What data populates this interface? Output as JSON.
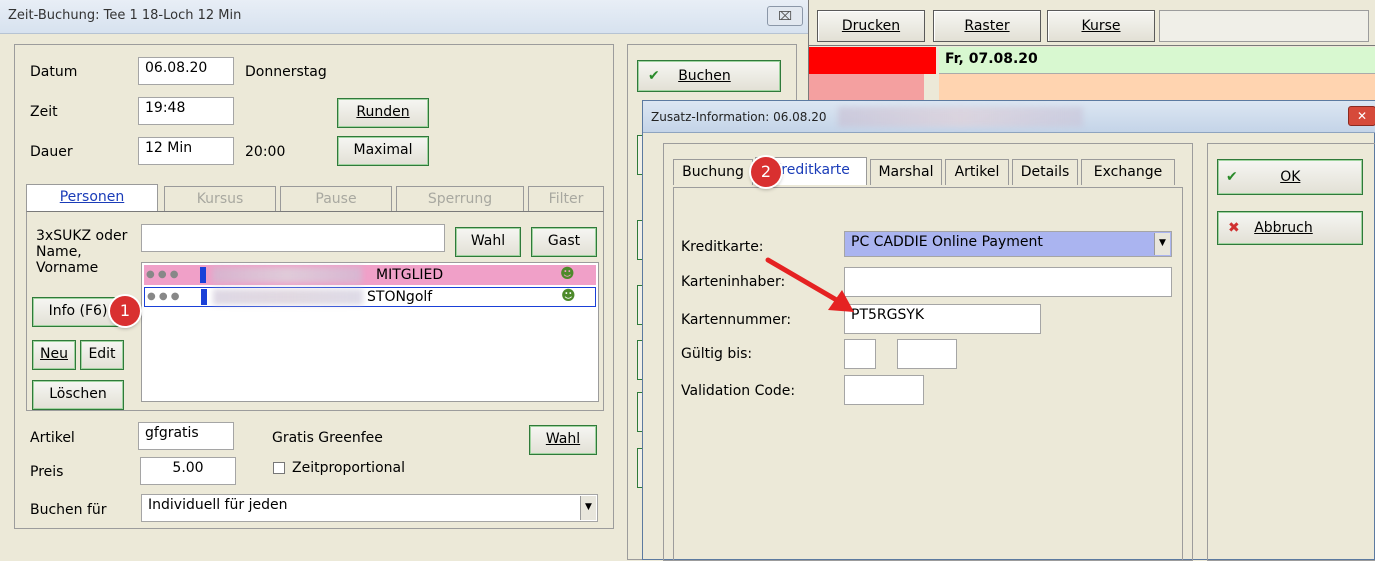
{
  "main_window": {
    "title": "Zeit-Buchung: Tee 1 18-Loch 12 Min",
    "close_label": "⌧",
    "datum_label": "Datum",
    "datum_value": "06.08.20",
    "weekday": "Donnerstag",
    "zeit_label": "Zeit",
    "zeit_value": "19:48",
    "runden_label": "Runden",
    "dauer_label": "Dauer",
    "dauer_value": "12 Min",
    "end_time": "20:00",
    "maximal_label": "Maximal",
    "tabs": [
      "Personen",
      "Kursus",
      "Pause",
      "Sperrung",
      "Filter"
    ],
    "search_label": "3xSUKZ oder Name, Vorname",
    "wahl_label": "Wahl",
    "gast_label": "Gast",
    "info_label": "Info (F6)",
    "neu_label": "Neu",
    "edit_label": "Edit",
    "loeschen_label": "Löschen",
    "persons": [
      {
        "suffix": "MITGLIED",
        "highlight": "#f0a0c8"
      },
      {
        "suffix": "STONgolf",
        "highlight": "#ffffff"
      }
    ],
    "artikel_label": "Artikel",
    "artikel_value": "gfgratis",
    "artikel_desc": "Gratis Greenfee",
    "artikel_wahl_label": "Wahl",
    "preis_label": "Preis",
    "preis_value": "5.00",
    "zeitproportional_label": "Zeitproportional",
    "buchen_fuer_label": "Buchen für",
    "buchen_fuer_value": "Individuell für jeden"
  },
  "buchen_button": "Buchen",
  "top_toolbar": {
    "drucken": "Drucken",
    "raster": "Raster",
    "kurse": "Kurse"
  },
  "calendar": {
    "date": "Fr, 07.08.20"
  },
  "dialog": {
    "title": "Zusatz-Information: 06.08.20",
    "tabs": [
      "Buchung",
      "Kreditkarte",
      "Marshal",
      "Artikel",
      "Details",
      "Exchange"
    ],
    "kreditkarte_label": "Kreditkarte:",
    "kreditkarte_value": "PC CADDIE Online Payment",
    "karteninhaber_label": "Karteninhaber:",
    "karteninhaber_value": "",
    "kartennummer_label": "Kartennummer:",
    "kartennummer_value": "PT5RGSYK",
    "gueltig_label": "Gültig bis:",
    "validation_label": "Validation Code:",
    "ok_label": "OK",
    "abbruch_label": "Abbruch"
  },
  "badges": {
    "one": "1",
    "two": "2"
  },
  "colors": {
    "accent_red": "#ff0000",
    "annotation_red": "#d93030",
    "tab_active": "#1a3cb8",
    "selected_field": "#aab4f0"
  }
}
